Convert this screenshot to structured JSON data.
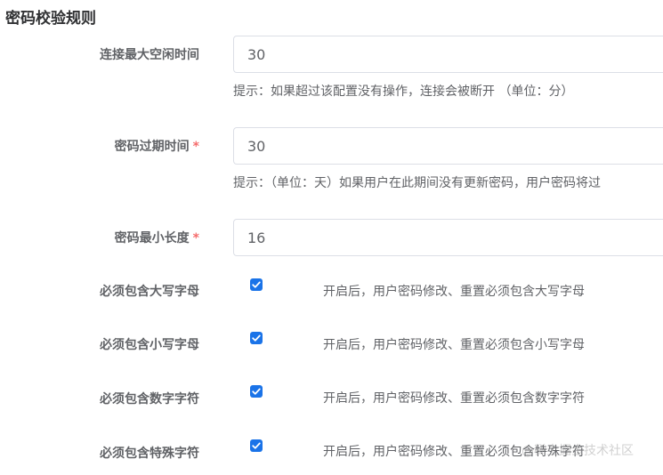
{
  "section": {
    "title": "密码校验规则"
  },
  "fields": [
    {
      "label": "连接最大空闲时间",
      "value": "30",
      "hint": "提示：如果超过该配置没有操作，连接会被断开 （单位：分）"
    },
    {
      "label": "密码过期时间",
      "required_mark": "*",
      "value": "30",
      "hint": "提示：（单位：天）如果用户在此期间没有更新密码，用户密码将过"
    },
    {
      "label": "密码最小长度",
      "required_mark": "*",
      "value": "16"
    }
  ],
  "checks": [
    {
      "label": "必须包含大写字母",
      "checked": true,
      "description": "开启后，用户密码修改、重置必须包含大写字母"
    },
    {
      "label": "必须包含小写字母",
      "checked": true,
      "description": "开启后，用户密码修改、重置必须包含小写字母"
    },
    {
      "label": "必须包含数字字符",
      "checked": true,
      "description": "开启后，用户密码修改、重置必须包含数字字符"
    },
    {
      "label": "必须包含特殊字符",
      "checked": true,
      "description": "开启后，用户密码修改、重置必须包含特殊字符"
    }
  ],
  "watermark": "@稀土掘金技术社区",
  "colors": {
    "accent": "#1a73e8",
    "required": "#f56c6c",
    "border": "#dcdfe6"
  }
}
